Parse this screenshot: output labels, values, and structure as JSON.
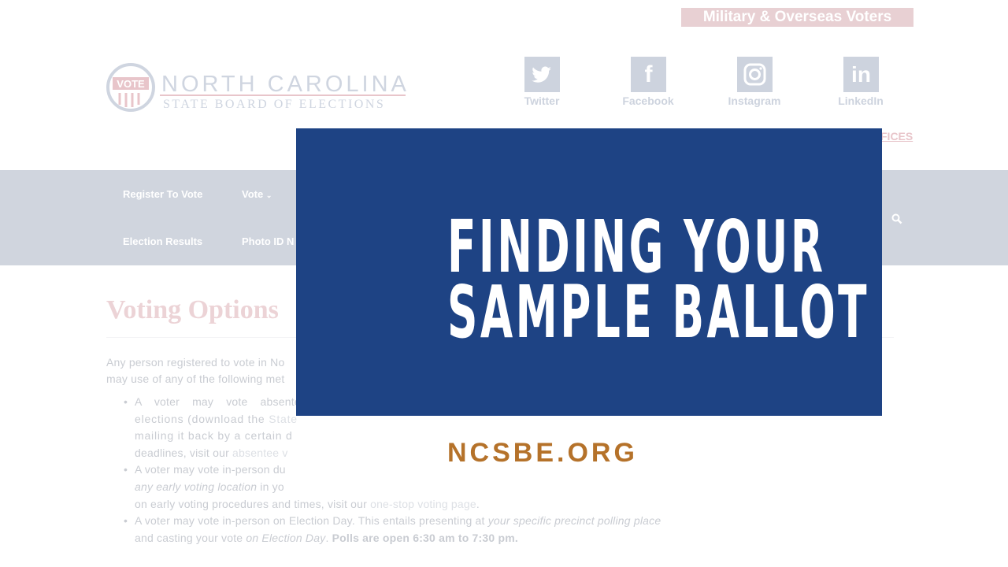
{
  "header": {
    "military_link": "Military & Overseas Voters",
    "logo_badge": "VOTE",
    "logo_line1": "NORTH CAROLINA",
    "logo_line2": "STATE BOARD OF ELECTIONS",
    "partial_link": "FICES"
  },
  "social": [
    {
      "label": "Twitter",
      "icon": "twitter-icon"
    },
    {
      "label": "Facebook",
      "glyph": "f",
      "icon": "facebook-icon"
    },
    {
      "label": "Instagram",
      "icon": "instagram-icon"
    },
    {
      "label": "LinkedIn",
      "glyph": "in",
      "icon": "linkedin-icon"
    }
  ],
  "nav": {
    "items": [
      "Register To Vote",
      "Vote",
      "Election Results",
      "Photo ID N"
    ],
    "chevron": "⌄",
    "search_icon": "search-icon"
  },
  "content": {
    "heading": "Voting Options",
    "lines": [
      "Any person registered to vote in No",
      "may use of any of the following met",
      "A voter may vote absentee",
      "elections (download the ",
      "State",
      "mailing it back by a certain d",
      "deadlines, visit our ",
      "absentee v",
      "A voter may vote in-person du",
      "any early voting location",
      " in yo",
      "on early voting procedures and times, visit our ",
      "one-stop voting page",
      ".",
      "A voter may vote in-person on Election Day. This entails presenting at ",
      "your specific precinct polling place",
      "and casting your vote ",
      "on Election Day",
      ". ",
      "Polls are open 6:30 am to 7:30 pm."
    ]
  },
  "overlay": {
    "title_line1": "FINDING YOUR",
    "title_line2": "SAMPLE BALLOT",
    "website": "NCSBE.ORG"
  },
  "colors": {
    "panel": "#1e4384",
    "website": "#b5722a",
    "nav": "#d0d5de"
  }
}
